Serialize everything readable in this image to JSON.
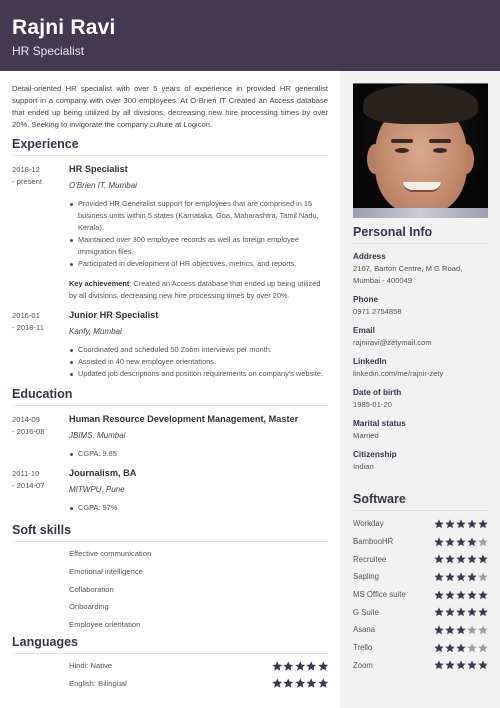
{
  "header": {
    "name": "Rajni Ravi",
    "title": "HR Specialist",
    "bg_color": "#433a52"
  },
  "summary": "Detail-oriented HR specialist with over 5 years of experience in provided HR generalist support in a company with over 300 employees. At O-Brien IT Created an Access database that ended up being utilized by all divisions, decreasing new hire processing times by over 20%. Seeking to invigorate the company culture at Logicon.",
  "experience": {
    "heading": "Experience",
    "items": [
      {
        "date_start": "2018-12",
        "date_end": "- present",
        "role": "HR Specialist",
        "org": "O'Brien IT, Mumbai",
        "bullets": [
          "Provided HR Generalist support for employees that are comprised in 15 business units within 5 states (Karnataka, Goa, Maharashtra, Tamil Nadu, Kerala).",
          "Maintained over 300 employee records as well as foreign employee immigration files.",
          "Participated in development of HR objectives, metrics, and reports."
        ],
        "key_label": "Key achievement",
        "key_text": ": Created an Access database that ended up being utilized by all divisions, decreasing new hire processing times by over 20%."
      },
      {
        "date_start": "2016-01",
        "date_end": "- 2018-11",
        "role": "Junior HR Specialist",
        "org": "Kanfy, Mumbai",
        "bullets": [
          "Coordinated and scheduled 50 Zoom interviews per month.",
          "Assisted in 40 new employee orientations.",
          "Updated job descriptions and position requirements on company's website."
        ]
      }
    ]
  },
  "education": {
    "heading": "Education",
    "items": [
      {
        "date_start": "2014-09",
        "date_end": "- 2016-08",
        "role": "Human Resource Development Management, Master",
        "org": "JBIMS, Mumbai",
        "bullets": [
          "CGPA: 9.85"
        ]
      },
      {
        "date_start": "2011-10",
        "date_end": "- 2014-07",
        "role": "Journalism, BA",
        "org": "MITWPU, Pune",
        "bullets": [
          "CGPA: 97%"
        ]
      }
    ]
  },
  "soft_skills": {
    "heading": "Soft skills",
    "items": [
      "Effective communication",
      "Emotional intelligence",
      "Collaboration",
      "Onboarding",
      "Employee orientation"
    ]
  },
  "languages": {
    "heading": "Languages",
    "items": [
      {
        "name": "Hindi: Native",
        "rating": 5,
        "max": 5
      },
      {
        "name": "English: Bilingual",
        "rating": 5,
        "max": 5
      }
    ]
  },
  "personal_info": {
    "heading": "Personal Info",
    "photo_alt": "profile-photo",
    "fields": [
      {
        "label": "Address",
        "value": "2107, Barton Centre, M G Road, Mumbai - 400049"
      },
      {
        "label": "Phone",
        "value": "0971 2754858"
      },
      {
        "label": "Email",
        "value": "rajniravi@zetymail.com"
      },
      {
        "label": "LinkedIn",
        "value": "linkedin.com/me/rajnir-zety"
      },
      {
        "label": "Date of birth",
        "value": "1985-01-20"
      },
      {
        "label": "Marital status",
        "value": "Married"
      },
      {
        "label": "Citizenship",
        "value": "Indian"
      }
    ]
  },
  "software": {
    "heading": "Software",
    "items": [
      {
        "name": "Workday",
        "rating": 5,
        "max": 5
      },
      {
        "name": "BambooHR",
        "rating": 4,
        "max": 5
      },
      {
        "name": "Recruitee",
        "rating": 5,
        "max": 5
      },
      {
        "name": "Sapling",
        "rating": 4,
        "max": 5
      },
      {
        "name": "MS Office suite",
        "rating": 5,
        "max": 5
      },
      {
        "name": "G Suite",
        "rating": 5,
        "max": 5
      },
      {
        "name": "Asana",
        "rating": 3,
        "max": 5
      },
      {
        "name": "Trello",
        "rating": 3,
        "max": 5
      },
      {
        "name": "Zoom",
        "rating": 5,
        "max": 5
      }
    ]
  },
  "colors": {
    "accent": "#433a52",
    "star_on": "#3f3850",
    "star_off": "#a09aa8",
    "sidebar_bg": "#f2f2f2"
  }
}
